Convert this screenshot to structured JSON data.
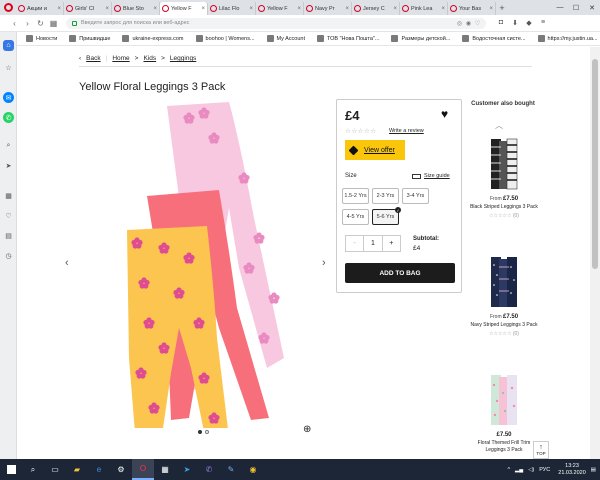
{
  "browser": {
    "tabs": [
      {
        "label": "Акции и"
      },
      {
        "label": "Girls' Cl"
      },
      {
        "label": "Blue Sto"
      },
      {
        "label": "Yellow F"
      },
      {
        "label": "Lilac Flo"
      },
      {
        "label": "Yellow F"
      },
      {
        "label": "Navy Pr"
      },
      {
        "label": "Jersey C"
      },
      {
        "label": "Pink Lea"
      },
      {
        "label": "Your Bas"
      }
    ],
    "active_tab": 3,
    "address_placeholder": "Введите запрос для поиска или веб-адрес",
    "bookmarks": [
      "Новости",
      "Пришвидше",
      "ukraine-express.com",
      "boohoo | Womens...",
      "My Account",
      "ТОВ \"Нова Пошта\"...",
      "Размеры детской...",
      "Водосточная систе...",
      "https://my.justin.ua..."
    ],
    "win_min": "—",
    "win_max": "☐",
    "win_close": "✕"
  },
  "breadcrumb": {
    "back": "Back",
    "home": "Home",
    "kids": "Kids",
    "leggings": "Leggings",
    "sep": ">"
  },
  "product": {
    "title": "Yellow Floral Leggings 3 Pack",
    "price": "£4",
    "write_review": "Write a review",
    "offer": "View offer",
    "size_label": "Size",
    "size_guide": "Size guide",
    "sizes": [
      "1.5-2 Yrs",
      "2-3 Yrs",
      "3-4 Yrs",
      "4-5 Yrs",
      "5-6 Yrs"
    ],
    "selected_size": "5-6 Yrs",
    "quantity": "1",
    "subtotal_label": "Subtotal:",
    "subtotal_value": "£4",
    "add_to_bag": "ADD TO BAG",
    "qty_minus": "-",
    "qty_plus": "+",
    "stars": "☆☆☆☆☆"
  },
  "recommendations": {
    "heading": "Customer also bought",
    "items": [
      {
        "from": "From",
        "price": "£7.50",
        "name": "Black Striped Leggings 3 Pack",
        "reviews": "(0)",
        "stars": "☆☆☆☆☆"
      },
      {
        "from": "From",
        "price": "£7.50",
        "name": "Navy Striped Leggings 3 Pack",
        "reviews": "(0)",
        "stars": "☆☆☆☆☆"
      },
      {
        "from": "",
        "price": "£7.50",
        "name": "Floral Themed Frill Trim Leggings 3 Pack",
        "reviews": "",
        "stars": ""
      }
    ]
  },
  "top_button": "TOP",
  "taskbar": {
    "lang": "РУС",
    "time": "13:23",
    "date": "21.03.2020"
  }
}
